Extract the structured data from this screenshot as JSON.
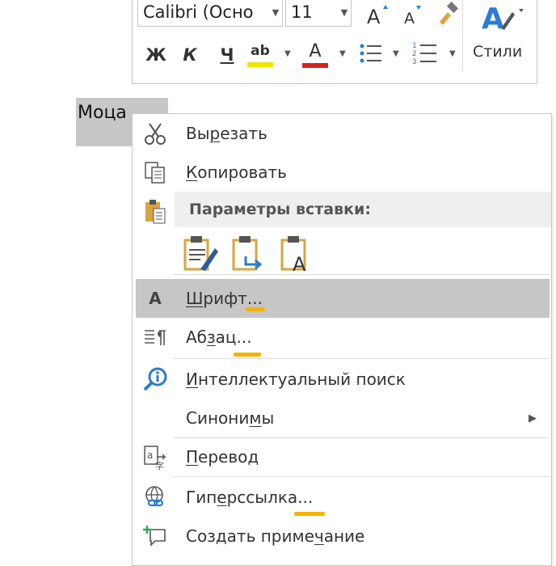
{
  "toolbar": {
    "font_name": "Calibri (Осно",
    "font_size": "11",
    "bold": "Ж",
    "italic": "К",
    "underline": "Ч",
    "highlight": "ab",
    "font_color_letter": "A",
    "styles_label": "Стили",
    "highlight_color": "#f0e400",
    "font_color": "#d9231c"
  },
  "document": {
    "selected_text": "Моца"
  },
  "menu": {
    "cut": {
      "pre": "Вы",
      "u": "р",
      "post": "езать"
    },
    "copy": {
      "pre": "",
      "u": "К",
      "post": "опировать"
    },
    "paste_header": "Параметры вставки:",
    "font": {
      "pre": "",
      "u": "Ш",
      "post": "рифт..."
    },
    "paragraph": {
      "pre": "Аб",
      "u": "з",
      "post": "ац..."
    },
    "smart_lookup": {
      "pre": "",
      "u": "И",
      "post": "нтеллектуальный поиск"
    },
    "synonyms": {
      "pre": "Синони",
      "u": "м",
      "post": "ы"
    },
    "translate": {
      "pre": "",
      "u": "П",
      "post": "еревод"
    },
    "hyperlink": {
      "pre": "Гип",
      "u": "е",
      "post": "рссылка..."
    },
    "comment": {
      "pre": "Создать приме",
      "u": "ч",
      "post": "ание"
    },
    "font_icon_letter": "A"
  },
  "colors": {
    "highlight_row": "#c6c6c6",
    "accent_marker": "#f5b400",
    "icon_blue": "#2b7cd3",
    "paste_tan": "#d9a441"
  }
}
